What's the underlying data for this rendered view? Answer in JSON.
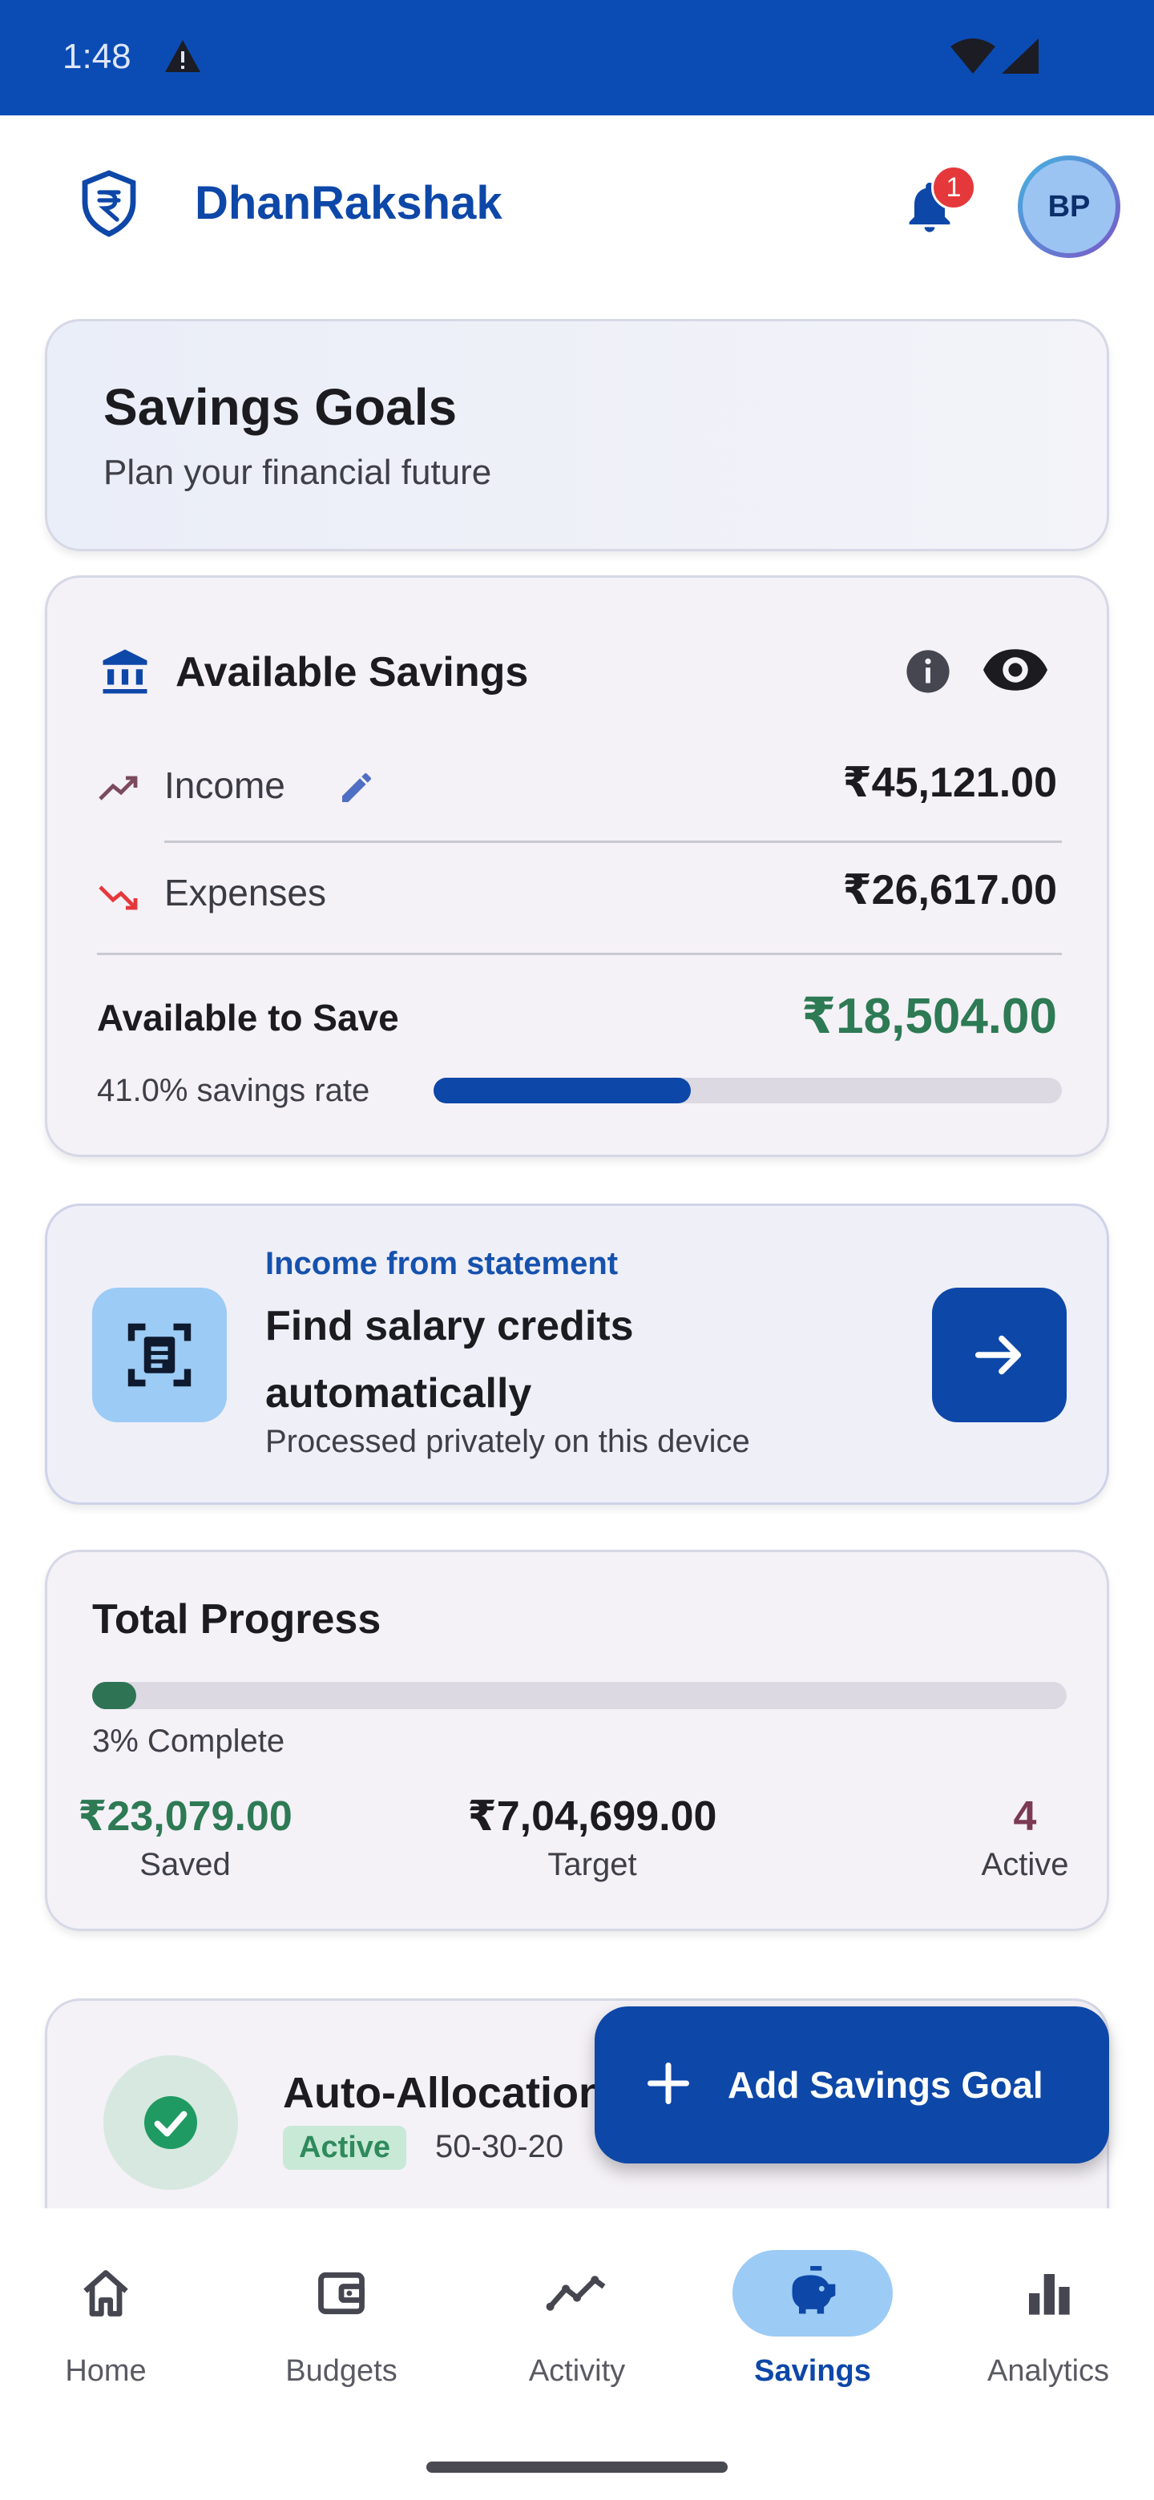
{
  "status_bar": {
    "time": "1:48"
  },
  "app_bar": {
    "title": "DhanRakshak",
    "notification_count": "1",
    "avatar_initials": "BP"
  },
  "header": {
    "title": "Savings Goals",
    "subtitle": "Plan your financial future"
  },
  "savings": {
    "title": "Available Savings",
    "income_label": "Income",
    "income_amount": "₹45,121.00",
    "expenses_label": "Expenses",
    "expenses_amount": "₹26,617.00",
    "available_label": "Available to Save",
    "available_amount": "₹18,504.00",
    "rate_text": "41.0% savings rate",
    "rate_fraction": 0.41
  },
  "statement": {
    "kicker": "Income from statement",
    "title": "Find salary credits automatically",
    "subtitle": "Processed privately on this device"
  },
  "progress": {
    "title": "Total Progress",
    "complete_text": "3% Complete",
    "complete_fraction": 0.03,
    "saved_value": "₹23,079.00",
    "saved_label": "Saved",
    "target_value": "₹7,04,699.00",
    "target_label": "Target",
    "active_value": "4",
    "active_label": "Active"
  },
  "auto_allocation": {
    "title": "Auto-Allocation",
    "status": "Active",
    "rule": "50-30-20"
  },
  "fab": {
    "label": "Add Savings Goal"
  },
  "nav": {
    "items": [
      {
        "label": "Home",
        "icon": "home-icon"
      },
      {
        "label": "Budgets",
        "icon": "wallet-icon"
      },
      {
        "label": "Activity",
        "icon": "activity-icon"
      },
      {
        "label": "Savings",
        "icon": "piggy-bank-icon",
        "active": true
      },
      {
        "label": "Analytics",
        "icon": "bar-chart-icon"
      }
    ]
  },
  "colors": {
    "primary": "#0d47a8",
    "success": "#2d7a54",
    "expense": "#e5383b",
    "active_count": "#7a3a52"
  }
}
